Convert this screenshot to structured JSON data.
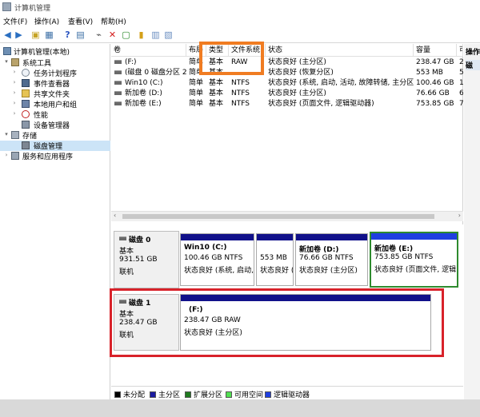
{
  "window": {
    "title": "计算机管理"
  },
  "menu": [
    "文件(F)",
    "操作(A)",
    "查看(V)",
    "帮助(H)"
  ],
  "toolbar_icons": [
    "back-icon",
    "forward-icon",
    "up-folder-icon",
    "console-tree-icon",
    "help-icon",
    "properties-icon",
    "connect-icon",
    "delete-icon",
    "check-icon",
    "export-icon",
    "import-icon",
    "wizard-icon"
  ],
  "tree": {
    "root": "计算机管理(本地)",
    "items": [
      {
        "label": "系统工具",
        "level": 1,
        "expander": "▾",
        "icon": "tools-icon"
      },
      {
        "label": "任务计划程序",
        "level": 2,
        "expander": "›",
        "icon": "clock-icon"
      },
      {
        "label": "事件查看器",
        "level": 2,
        "expander": "›",
        "icon": "event-viewer-icon"
      },
      {
        "label": "共享文件夹",
        "level": 2,
        "expander": "›",
        "icon": "shared-folder-icon"
      },
      {
        "label": "本地用户和组",
        "level": 2,
        "expander": "›",
        "icon": "users-icon"
      },
      {
        "label": "性能",
        "level": 2,
        "expander": "›",
        "icon": "performance-icon"
      },
      {
        "label": "设备管理器",
        "level": 2,
        "expander": "",
        "icon": "device-manager-icon"
      },
      {
        "label": "存储",
        "level": 1,
        "expander": "▾",
        "icon": "storage-icon"
      },
      {
        "label": "磁盘管理",
        "level": 2,
        "expander": "",
        "icon": "disk-icon",
        "selected": true
      },
      {
        "label": "服务和应用程序",
        "level": 1,
        "expander": "›",
        "icon": "services-icon"
      }
    ]
  },
  "volume_table": {
    "headers": [
      "卷",
      "布局",
      "类型",
      "文件系统",
      "状态",
      "容量",
      "可"
    ],
    "rows": [
      {
        "vol": "(F:)",
        "layout": "简单",
        "type": "基本",
        "fs": "RAW",
        "status": "状态良好 (主分区)",
        "capacity": "238.47 GB",
        "free": "2"
      },
      {
        "vol": "(磁盘 0 磁盘分区 2)",
        "layout": "简单",
        "type": "基本",
        "fs": "",
        "status": "状态良好 (恢复分区)",
        "capacity": "553 MB",
        "free": "5"
      },
      {
        "vol": "Win10 (C:)",
        "layout": "简单",
        "type": "基本",
        "fs": "NTFS",
        "status": "状态良好 (系统, 启动, 活动, 故障转储, 主分区)",
        "capacity": "100.46 GB",
        "free": "1"
      },
      {
        "vol": "新加卷 (D:)",
        "layout": "简单",
        "type": "基本",
        "fs": "NTFS",
        "status": "状态良好 (主分区)",
        "capacity": "76.66 GB",
        "free": "6"
      },
      {
        "vol": "新加卷 (E:)",
        "layout": "简单",
        "type": "基本",
        "fs": "NTFS",
        "status": "状态良好 (页面文件, 逻辑驱动器)",
        "capacity": "753.85 GB",
        "free": "7"
      }
    ]
  },
  "actions_header": "操作",
  "actions_item": "磁",
  "disks": [
    {
      "name": "磁盘 0",
      "kind": "基本",
      "size": "931.51 GB",
      "state": "联机",
      "partitions": [
        {
          "name": "Win10  (C:)",
          "line1": "100.46 GB NTFS",
          "line2": "状态良好 (系统, 启动,"
        },
        {
          "name": "",
          "line1": "553 MB",
          "line2": "状态良好 ("
        },
        {
          "name": "新加卷  (D:)",
          "line1": "76.66 GB NTFS",
          "line2": "状态良好 (主分区)"
        },
        {
          "name": "新加卷  (E:)",
          "line1": "753.85 GB NTFS",
          "line2": "状态良好 (页面文件, 逻辑"
        }
      ]
    },
    {
      "name": "磁盘 1",
      "kind": "基本",
      "size": "238.47 GB",
      "state": "联机",
      "partitions": [
        {
          "name": "(F:)",
          "line1": "238.47 GB RAW",
          "line2": "状态良好 (主分区)"
        }
      ]
    }
  ],
  "legend": [
    {
      "label": "未分配",
      "color": "#000000"
    },
    {
      "label": "主分区",
      "color": "#1a1aa0"
    },
    {
      "label": "扩展分区",
      "color": "#1f7a1f"
    },
    {
      "label": "可用空间",
      "color": "#52e052"
    },
    {
      "label": "逻辑驱动器",
      "color": "#1f3fe0"
    }
  ],
  "colors": {
    "partition_bar": "#11118a",
    "annotation_orange": "#f07c22",
    "annotation_red": "#d8222a",
    "selected_partition_border": "#2e8b2e"
  }
}
